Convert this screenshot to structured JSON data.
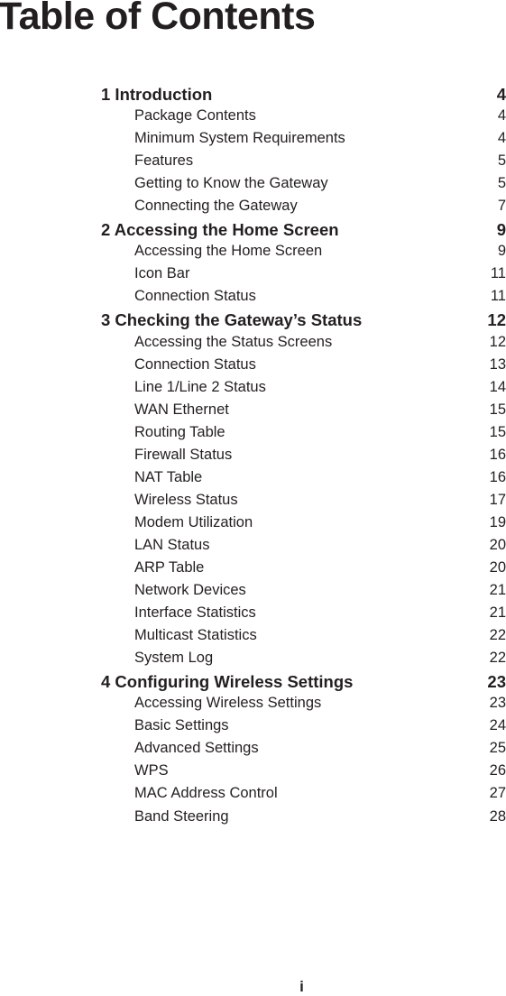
{
  "title": "Table of Contents",
  "toc": [
    {
      "label": "1 Introduction",
      "page": "4",
      "sections": [
        {
          "label": "Package Contents",
          "page": "4"
        },
        {
          "label": "Minimum System Requirements",
          "page": "4"
        },
        {
          "label": "Features",
          "page": "5"
        },
        {
          "label": "Getting to Know the Gateway",
          "page": "5"
        },
        {
          "label": "Connecting the Gateway",
          "page": "7"
        }
      ]
    },
    {
      "label": "2 Accessing the Home Screen",
      "page": "9",
      "sections": [
        {
          "label": "Accessing the Home Screen",
          "page": "9"
        },
        {
          "label": "Icon Bar",
          "page": "11"
        },
        {
          "label": "Connection Status",
          "page": "11"
        }
      ]
    },
    {
      "label": "3 Checking the Gateway’s Status",
      "page": "12",
      "sections": [
        {
          "label": "Accessing the Status Screens",
          "page": "12"
        },
        {
          "label": "Connection Status",
          "page": "13"
        },
        {
          "label": "Line 1/Line 2 Status",
          "page": "14"
        },
        {
          "label": "WAN Ethernet",
          "page": "15"
        },
        {
          "label": "Routing Table",
          "page": "15"
        },
        {
          "label": "Firewall Status",
          "page": "16"
        },
        {
          "label": "NAT Table",
          "page": "16"
        },
        {
          "label": "Wireless Status",
          "page": "17"
        },
        {
          "label": "Modem Utilization",
          "page": "19"
        },
        {
          "label": "LAN Status",
          "page": "20"
        },
        {
          "label": "ARP Table",
          "page": "20"
        },
        {
          "label": "Network Devices",
          "page": "21"
        },
        {
          "label": "Interface Statistics",
          "page": "21"
        },
        {
          "label": "Multicast Statistics",
          "page": "22"
        },
        {
          "label": "System Log",
          "page": "22"
        }
      ]
    },
    {
      "label": "4 Configuring Wireless Settings",
      "page": "23",
      "sections": [
        {
          "label": "Accessing Wireless Settings",
          "page": "23"
        },
        {
          "label": "Basic Settings",
          "page": "24"
        },
        {
          "label": "Advanced Settings",
          "page": "25"
        },
        {
          "label": "WPS",
          "page": "26"
        },
        {
          "label": "MAC Address Control",
          "page": "27"
        },
        {
          "label": "Band Steering",
          "page": "28"
        }
      ]
    }
  ],
  "footer": {
    "page_number": "i"
  }
}
